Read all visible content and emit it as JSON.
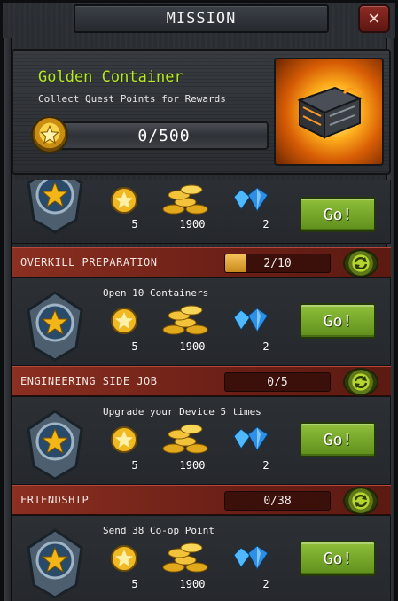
{
  "window": {
    "title": "MISSION"
  },
  "header": {
    "title": "Golden Container",
    "subtitle": "Collect Quest Points for Rewards",
    "progress_text": "0/500",
    "progress_fraction": 0
  },
  "colors": {
    "accent_green": "#b7e531",
    "mission_header_red": "#8b2f21",
    "go_button_green": "#7aa92c"
  },
  "missions": [
    {
      "name": "",
      "count": "",
      "description": "",
      "rewards": {
        "medal": "5",
        "coins": "1900",
        "gems": "2"
      },
      "go_label": "Go!"
    },
    {
      "name": "OVERKILL PREPARATION",
      "count": "2/10",
      "progress_fraction": 0.2,
      "description": "Open 10 Containers",
      "rewards": {
        "medal": "5",
        "coins": "1900",
        "gems": "2"
      },
      "go_label": "Go!"
    },
    {
      "name": "ENGINEERING SIDE JOB",
      "count": "0/5",
      "progress_fraction": 0,
      "description": "Upgrade your Device 5 times",
      "rewards": {
        "medal": "5",
        "coins": "1900",
        "gems": "2"
      },
      "go_label": "Go!"
    },
    {
      "name": "FRIENDSHIP",
      "count": "0/38",
      "progress_fraction": 0,
      "description": "Send 38 Co-op Point",
      "rewards": {
        "medal": "5",
        "coins": "1900",
        "gems": "2"
      },
      "go_label": "Go!"
    }
  ],
  "icons": {
    "close": "close-icon",
    "medal": "quest-medal-icon",
    "coins": "gold-coins-icon",
    "gems": "blue-gems-icon",
    "refresh": "refresh-icon",
    "chest": "golden-container-icon",
    "rank": "rank-badge-icon"
  }
}
